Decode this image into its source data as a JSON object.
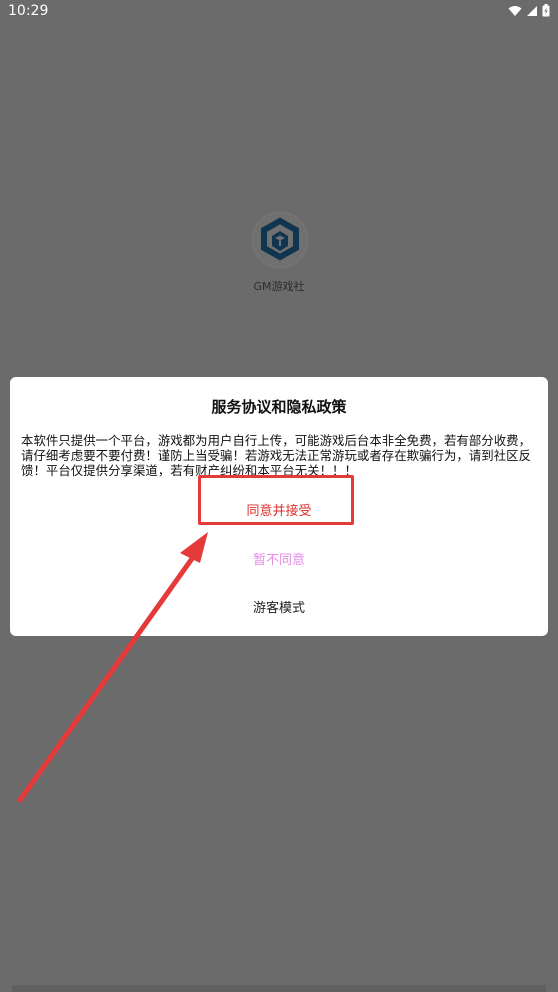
{
  "status_bar": {
    "time": "10:29"
  },
  "app": {
    "name": "GM游戏社"
  },
  "dialog": {
    "title": "服务协议和隐私政策",
    "body": "本软件只提供一个平台，游戏都为用户自行上传，可能游戏后台本非全免费，若有部分收费，请仔细考虑要不要付费！谨防上当受骗！若游戏无法正常游玩或者存在欺骗行为，请到社区反馈！平台仅提供分享渠道，若有财产纠纷和本平台无关！！！",
    "agree_label": "同意并接受",
    "disagree_label": "暂不同意",
    "guest_label": "游客模式"
  },
  "colors": {
    "overlay": "#6b6b6b",
    "agree": "#e0302d",
    "disagree": "#e68ce8",
    "annotation": "#e53a3a",
    "logo": "#0f3550"
  }
}
